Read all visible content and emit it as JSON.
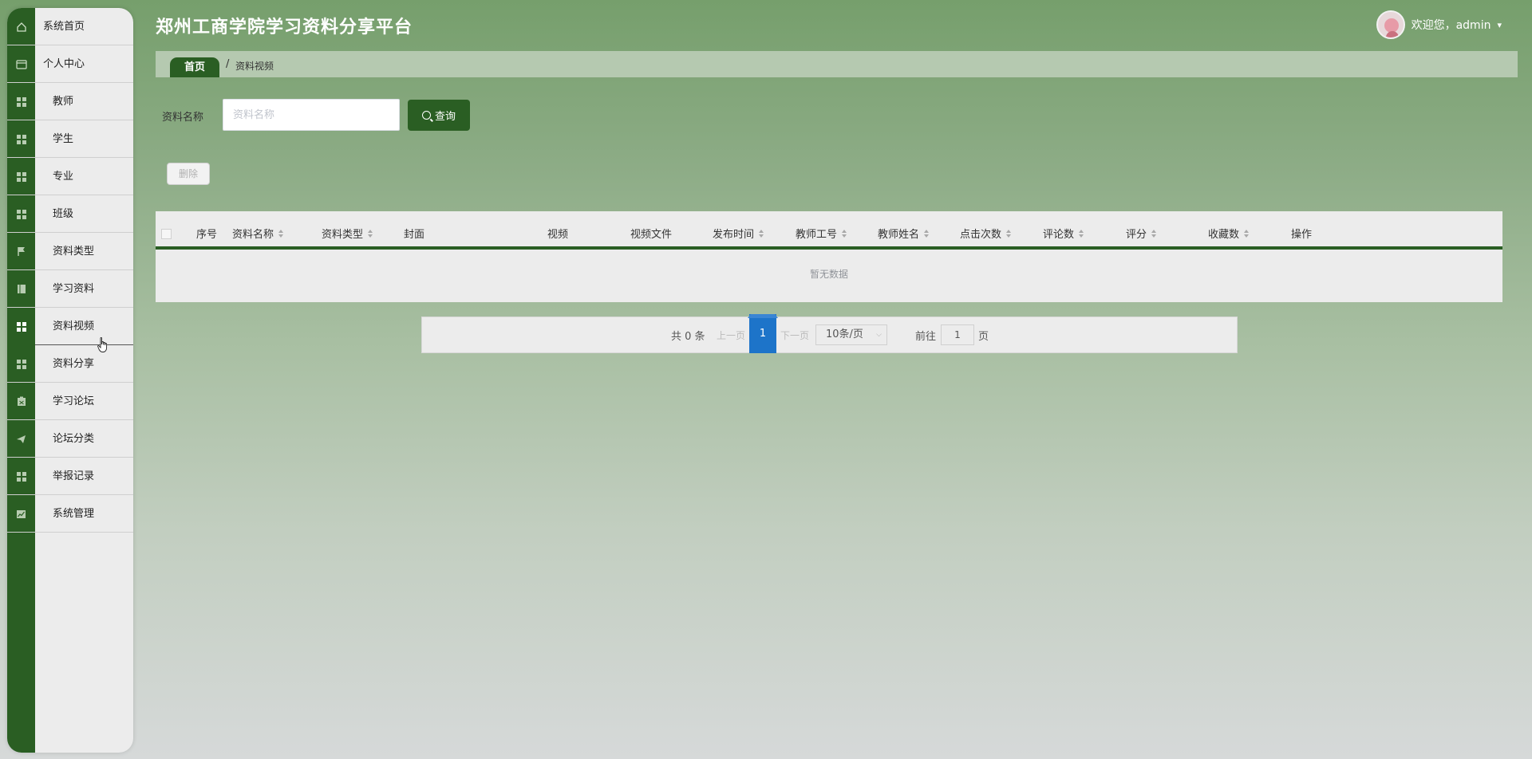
{
  "header": {
    "site_title": "郑州工商学院学习资料分享平台",
    "welcome": "欢迎您，admin",
    "caret": "▾"
  },
  "sidebar": {
    "items": [
      {
        "label": "系统首页",
        "icon": "home-icon"
      },
      {
        "label": "个人中心",
        "icon": "card-icon"
      },
      {
        "label": "教师",
        "icon": "grid-icon"
      },
      {
        "label": "学生",
        "icon": "grid-icon"
      },
      {
        "label": "专业",
        "icon": "grid-icon"
      },
      {
        "label": "班级",
        "icon": "grid-icon"
      },
      {
        "label": "资料类型",
        "icon": "flag-icon"
      },
      {
        "label": "学习资料",
        "icon": "book-icon"
      },
      {
        "label": "资料视频",
        "icon": "grid-icon",
        "active": true
      },
      {
        "label": "资料分享",
        "icon": "grid-icon"
      },
      {
        "label": "学习论坛",
        "icon": "clipboard-icon"
      },
      {
        "label": "论坛分类",
        "icon": "send-icon"
      },
      {
        "label": "举报记录",
        "icon": "grid-icon"
      },
      {
        "label": "系统管理",
        "icon": "chart-icon"
      }
    ]
  },
  "breadcrumb": {
    "home": "首页",
    "separator": "/",
    "current": "资料视频"
  },
  "search": {
    "label": "资料名称",
    "placeholder": "资料名称",
    "value": "",
    "button": "查询"
  },
  "actions": {
    "delete": "删除"
  },
  "table": {
    "columns": [
      "序号",
      "资料名称",
      "资料类型",
      "封面",
      "视频",
      "视频文件",
      "发布时间",
      "教师工号",
      "教师姓名",
      "点击次数",
      "评论数",
      "评分",
      "收藏数",
      "操作"
    ],
    "rows": [],
    "empty_text": "暂无数据"
  },
  "pagination": {
    "total": "共 0 条",
    "prev": "上一页",
    "current": "1",
    "next": "下一页",
    "page_size": "10条/页",
    "goto_label": "前往",
    "goto_value": "1",
    "goto_unit": "页"
  },
  "colors": {
    "primary": "#2a5e23",
    "accent": "#1d74c9"
  }
}
